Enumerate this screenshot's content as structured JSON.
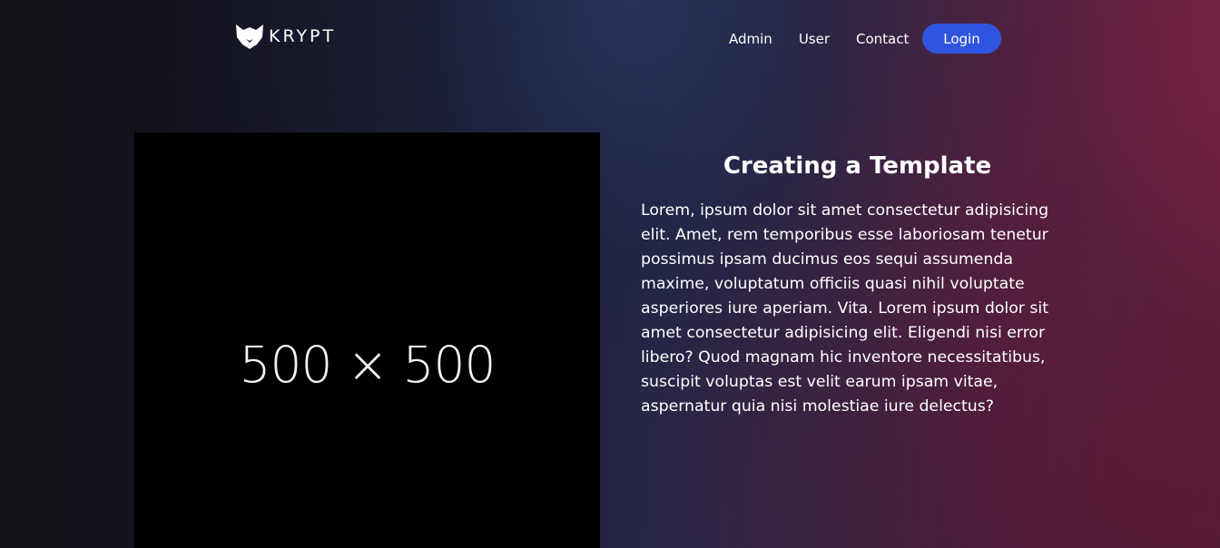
{
  "brand": {
    "name": "KRYPT",
    "logo_icon": "fox-head-icon"
  },
  "nav": {
    "links": [
      "Admin",
      "User",
      "Contact"
    ],
    "login_label": "Login"
  },
  "image_placeholder": {
    "label": "500 × 500"
  },
  "content": {
    "title": "Creating a Template",
    "body": "Lorem, ipsum dolor sit amet consectetur adipisicing elit. Amet, rem temporibus esse laboriosam tenetur possimus ipsam ducimus eos sequi assumenda maxime, voluptatum officiis quasi nihil voluptate asperiores iure aperiam. Vita. Lorem ipsum dolor sit amet consectetur adipisicing elit. Eligendi nisi error libero? Quod magnam hic inventore necessitatibus, suscipit voluptas est velit earum ipsam vitae, aspernatur quia nisi molestiae iure delectus?"
  },
  "colors": {
    "accent": "#2f55e0",
    "image_bg": "#000000",
    "text": "#ffffff"
  }
}
